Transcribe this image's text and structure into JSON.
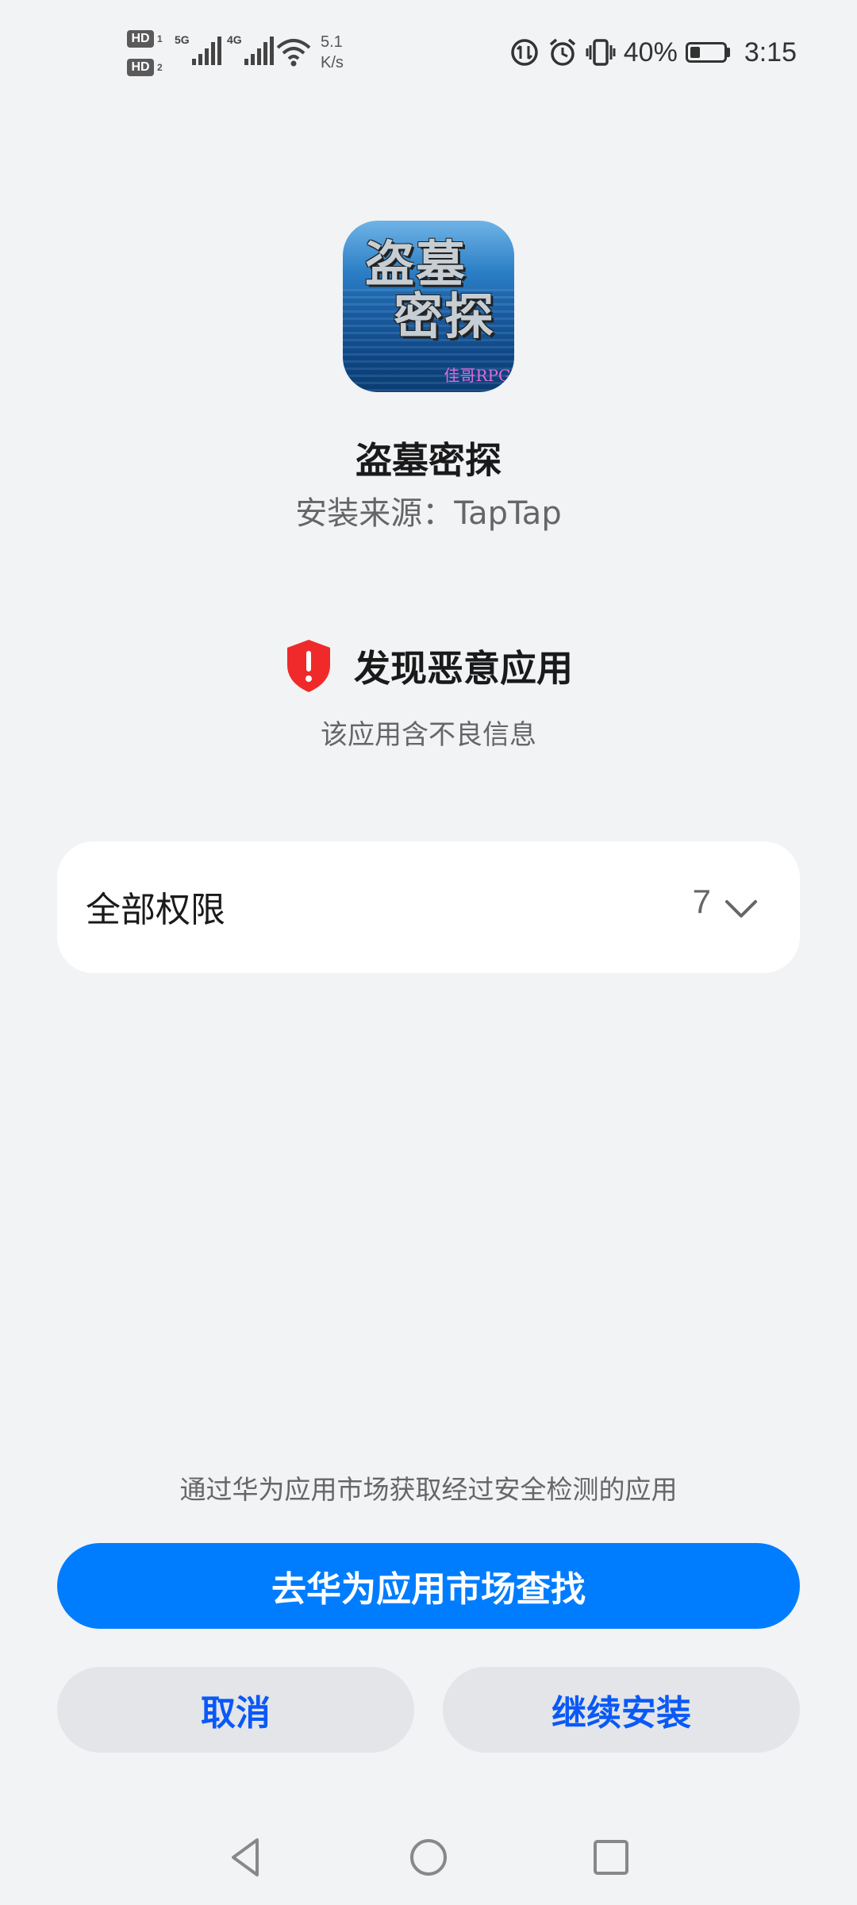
{
  "status_bar": {
    "hd1": "HD",
    "hd1_sub": "1",
    "hd2": "HD",
    "hd2_sub": "2",
    "sig1_label": "5G",
    "sig2_label": "4G",
    "net_speed_value": "5.1",
    "net_speed_unit": "K/s",
    "battery_percent": "40%",
    "battery_level": 0.4,
    "time": "3:15"
  },
  "app": {
    "icon_line1": "盗墓",
    "icon_line2": "密探",
    "icon_brand": "佳哥RPG",
    "name": "盗墓密探",
    "source": "安装来源：TapTap"
  },
  "warning": {
    "title": "发现恶意应用",
    "subtitle": "该应用含不良信息",
    "color": "#f02a2a"
  },
  "permissions": {
    "label": "全部权限",
    "count": "7"
  },
  "footer": {
    "hint": "通过华为应用市场获取经过安全检测的应用",
    "primary_button": "去华为应用市场查找",
    "cancel_button": "取消",
    "continue_button": "继续安装"
  },
  "colors": {
    "accent": "#007dff",
    "secondary_text_button": "#0a59f7",
    "background": "#f1f3f5"
  }
}
